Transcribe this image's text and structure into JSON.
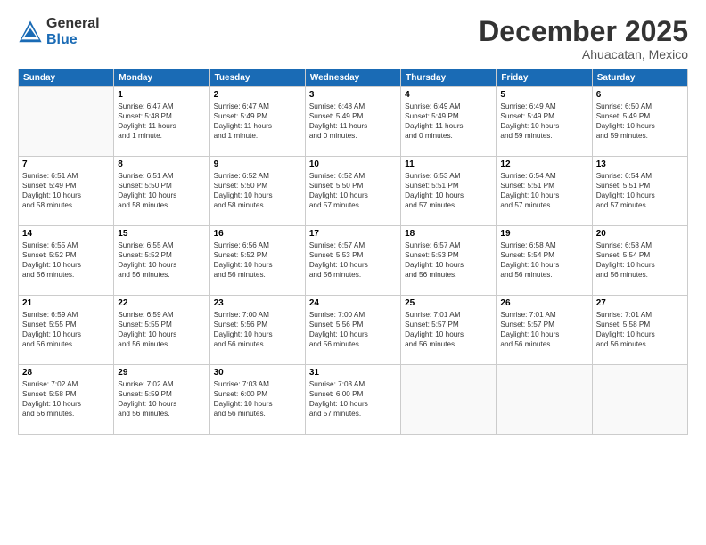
{
  "header": {
    "logo_general": "General",
    "logo_blue": "Blue",
    "month": "December 2025",
    "location": "Ahuacatan, Mexico"
  },
  "weekdays": [
    "Sunday",
    "Monday",
    "Tuesday",
    "Wednesday",
    "Thursday",
    "Friday",
    "Saturday"
  ],
  "weeks": [
    [
      {
        "day": "",
        "info": ""
      },
      {
        "day": "1",
        "info": "Sunrise: 6:47 AM\nSunset: 5:48 PM\nDaylight: 11 hours\nand 1 minute."
      },
      {
        "day": "2",
        "info": "Sunrise: 6:47 AM\nSunset: 5:49 PM\nDaylight: 11 hours\nand 1 minute."
      },
      {
        "day": "3",
        "info": "Sunrise: 6:48 AM\nSunset: 5:49 PM\nDaylight: 11 hours\nand 0 minutes."
      },
      {
        "day": "4",
        "info": "Sunrise: 6:49 AM\nSunset: 5:49 PM\nDaylight: 11 hours\nand 0 minutes."
      },
      {
        "day": "5",
        "info": "Sunrise: 6:49 AM\nSunset: 5:49 PM\nDaylight: 10 hours\nand 59 minutes."
      },
      {
        "day": "6",
        "info": "Sunrise: 6:50 AM\nSunset: 5:49 PM\nDaylight: 10 hours\nand 59 minutes."
      }
    ],
    [
      {
        "day": "7",
        "info": "Sunrise: 6:51 AM\nSunset: 5:49 PM\nDaylight: 10 hours\nand 58 minutes."
      },
      {
        "day": "8",
        "info": "Sunrise: 6:51 AM\nSunset: 5:50 PM\nDaylight: 10 hours\nand 58 minutes."
      },
      {
        "day": "9",
        "info": "Sunrise: 6:52 AM\nSunset: 5:50 PM\nDaylight: 10 hours\nand 58 minutes."
      },
      {
        "day": "10",
        "info": "Sunrise: 6:52 AM\nSunset: 5:50 PM\nDaylight: 10 hours\nand 57 minutes."
      },
      {
        "day": "11",
        "info": "Sunrise: 6:53 AM\nSunset: 5:51 PM\nDaylight: 10 hours\nand 57 minutes."
      },
      {
        "day": "12",
        "info": "Sunrise: 6:54 AM\nSunset: 5:51 PM\nDaylight: 10 hours\nand 57 minutes."
      },
      {
        "day": "13",
        "info": "Sunrise: 6:54 AM\nSunset: 5:51 PM\nDaylight: 10 hours\nand 57 minutes."
      }
    ],
    [
      {
        "day": "14",
        "info": "Sunrise: 6:55 AM\nSunset: 5:52 PM\nDaylight: 10 hours\nand 56 minutes."
      },
      {
        "day": "15",
        "info": "Sunrise: 6:55 AM\nSunset: 5:52 PM\nDaylight: 10 hours\nand 56 minutes."
      },
      {
        "day": "16",
        "info": "Sunrise: 6:56 AM\nSunset: 5:52 PM\nDaylight: 10 hours\nand 56 minutes."
      },
      {
        "day": "17",
        "info": "Sunrise: 6:57 AM\nSunset: 5:53 PM\nDaylight: 10 hours\nand 56 minutes."
      },
      {
        "day": "18",
        "info": "Sunrise: 6:57 AM\nSunset: 5:53 PM\nDaylight: 10 hours\nand 56 minutes."
      },
      {
        "day": "19",
        "info": "Sunrise: 6:58 AM\nSunset: 5:54 PM\nDaylight: 10 hours\nand 56 minutes."
      },
      {
        "day": "20",
        "info": "Sunrise: 6:58 AM\nSunset: 5:54 PM\nDaylight: 10 hours\nand 56 minutes."
      }
    ],
    [
      {
        "day": "21",
        "info": "Sunrise: 6:59 AM\nSunset: 5:55 PM\nDaylight: 10 hours\nand 56 minutes."
      },
      {
        "day": "22",
        "info": "Sunrise: 6:59 AM\nSunset: 5:55 PM\nDaylight: 10 hours\nand 56 minutes."
      },
      {
        "day": "23",
        "info": "Sunrise: 7:00 AM\nSunset: 5:56 PM\nDaylight: 10 hours\nand 56 minutes."
      },
      {
        "day": "24",
        "info": "Sunrise: 7:00 AM\nSunset: 5:56 PM\nDaylight: 10 hours\nand 56 minutes."
      },
      {
        "day": "25",
        "info": "Sunrise: 7:01 AM\nSunset: 5:57 PM\nDaylight: 10 hours\nand 56 minutes."
      },
      {
        "day": "26",
        "info": "Sunrise: 7:01 AM\nSunset: 5:57 PM\nDaylight: 10 hours\nand 56 minutes."
      },
      {
        "day": "27",
        "info": "Sunrise: 7:01 AM\nSunset: 5:58 PM\nDaylight: 10 hours\nand 56 minutes."
      }
    ],
    [
      {
        "day": "28",
        "info": "Sunrise: 7:02 AM\nSunset: 5:58 PM\nDaylight: 10 hours\nand 56 minutes."
      },
      {
        "day": "29",
        "info": "Sunrise: 7:02 AM\nSunset: 5:59 PM\nDaylight: 10 hours\nand 56 minutes."
      },
      {
        "day": "30",
        "info": "Sunrise: 7:03 AM\nSunset: 6:00 PM\nDaylight: 10 hours\nand 56 minutes."
      },
      {
        "day": "31",
        "info": "Sunrise: 7:03 AM\nSunset: 6:00 PM\nDaylight: 10 hours\nand 57 minutes."
      },
      {
        "day": "",
        "info": ""
      },
      {
        "day": "",
        "info": ""
      },
      {
        "day": "",
        "info": ""
      }
    ]
  ]
}
